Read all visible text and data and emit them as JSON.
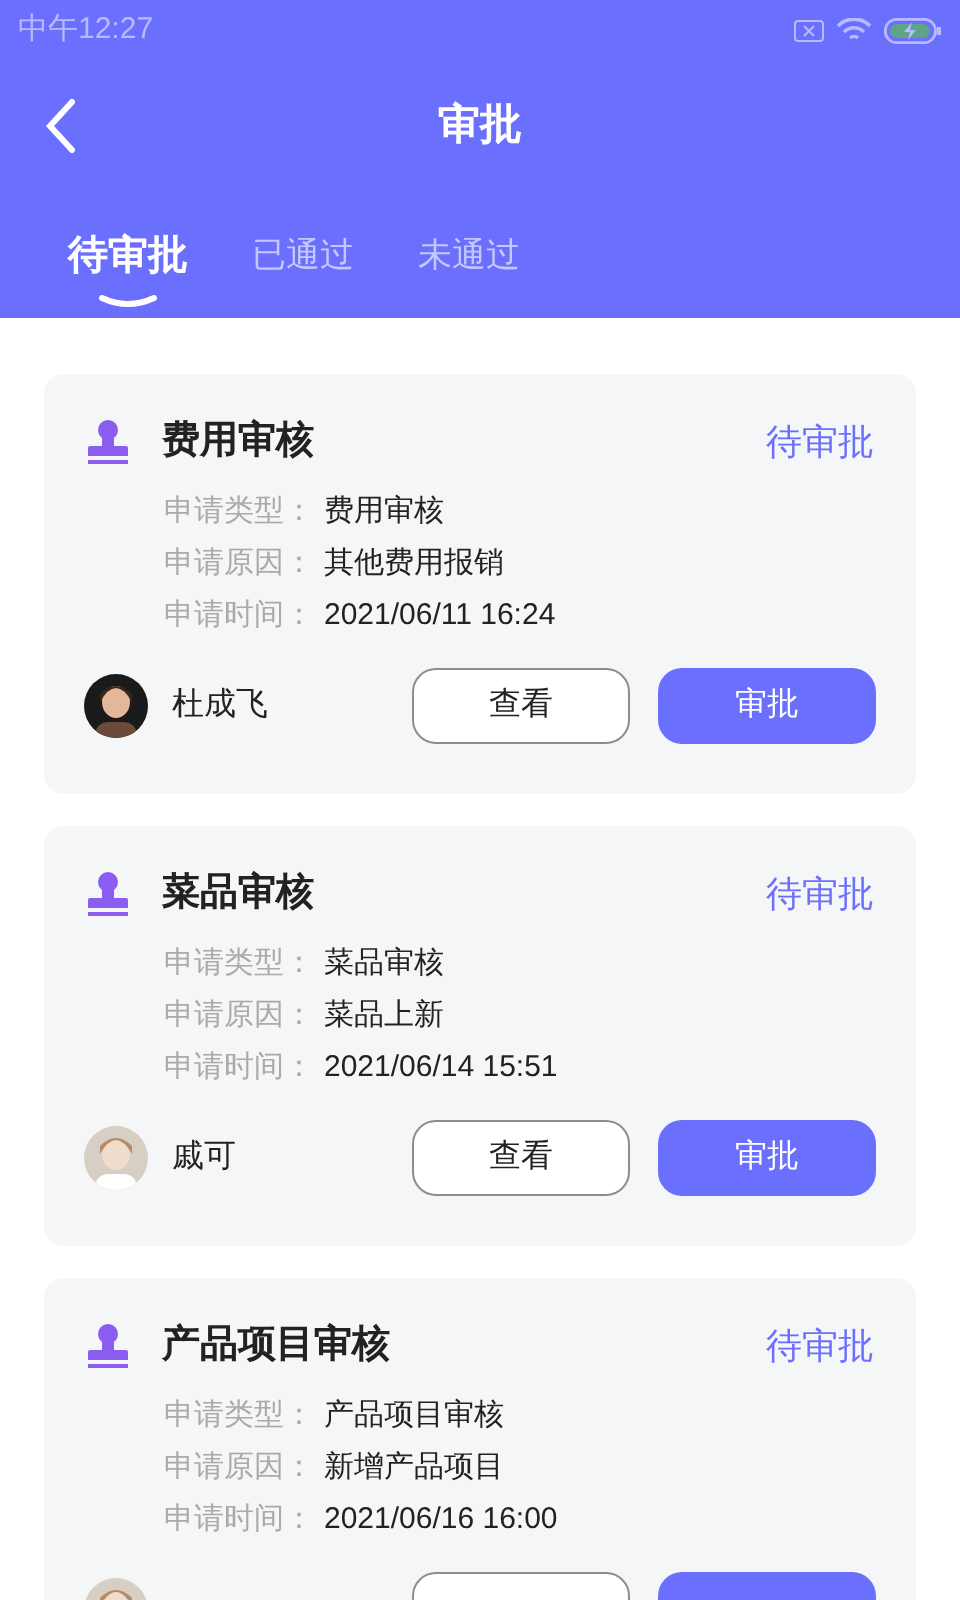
{
  "status_bar": {
    "time": "中午12:27"
  },
  "header": {
    "title": "审批"
  },
  "tabs": [
    {
      "label": "待审批",
      "selected": true
    },
    {
      "label": "已通过",
      "selected": false
    },
    {
      "label": "未通过",
      "selected": false
    }
  ],
  "cards": [
    {
      "title": "费用审核",
      "status": "待审批",
      "fields": [
        {
          "label": "申请类型：",
          "value": "费用审核"
        },
        {
          "label": "申请原因：",
          "value": "其他费用报销"
        },
        {
          "label": "申请时间：",
          "value": "2021/06/11 16:24"
        }
      ],
      "applicant": {
        "avatar": {
          "kind": "picture"
        },
        "name": "杜成飞"
      },
      "actions": [
        {
          "kind": "outline",
          "label": "查看"
        },
        {
          "kind": "primary",
          "label": "审批"
        }
      ]
    },
    {
      "title": "菜品审核",
      "status": "待审批",
      "fields": [
        {
          "label": "申请类型：",
          "value": "菜品审核"
        },
        {
          "label": "申请原因：",
          "value": "菜品上新"
        },
        {
          "label": "申请时间：",
          "value": "2021/06/14 15:51"
        }
      ],
      "applicant": {
        "avatar": {
          "kind": "picture"
        },
        "name": "戚可"
      },
      "actions": [
        {
          "kind": "outline",
          "label": "查看"
        },
        {
          "kind": "primary",
          "label": "审批"
        }
      ]
    },
    {
      "title": "产品项目审核",
      "status": "待审批",
      "fields": [
        {
          "label": "申请类型：",
          "value": "产品项目审核"
        },
        {
          "label": "申请原因：",
          "value": "新增产品项目"
        },
        {
          "label": "申请时间：",
          "value": "2021/06/16 16:00"
        }
      ],
      "applicant": {
        "avatar": {
          "kind": "picture"
        }
      },
      "actions": [
        {
          "kind": "outline"
        },
        {
          "kind": "primary"
        }
      ]
    }
  ]
}
